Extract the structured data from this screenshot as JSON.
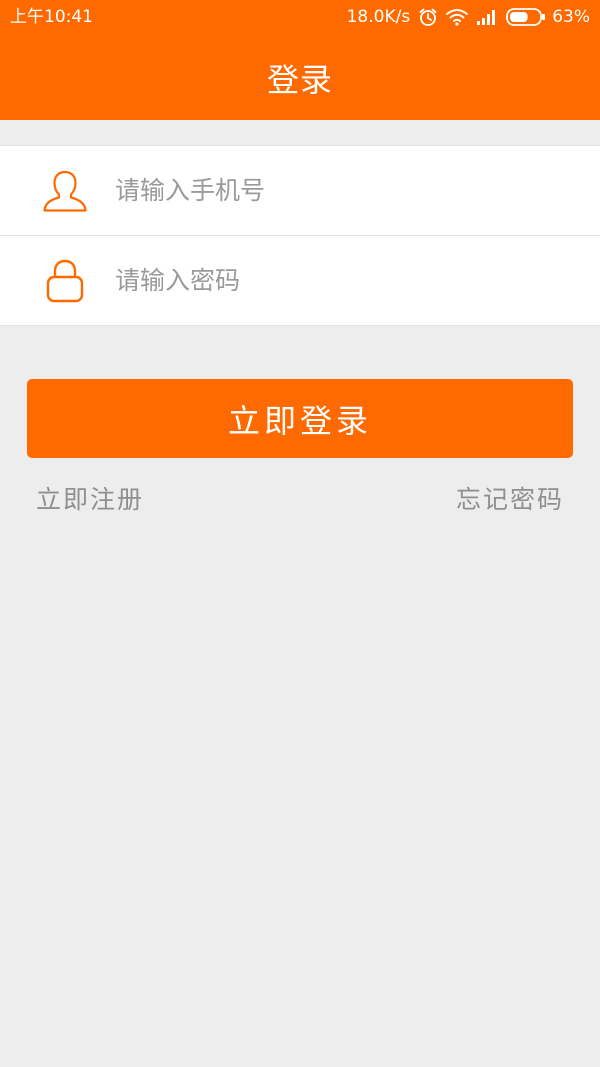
{
  "status_bar": {
    "time": "上午10:41",
    "network_speed": "18.0K/s",
    "battery_percent": "63%",
    "battery_level": 0.63,
    "icons": [
      "alarm-icon",
      "wifi-icon",
      "signal-icon",
      "battery-icon"
    ]
  },
  "header": {
    "title": "登录"
  },
  "form": {
    "phone": {
      "placeholder": "请输入手机号",
      "value": "",
      "icon": "user-icon"
    },
    "password": {
      "placeholder": "请输入密码",
      "value": "",
      "icon": "lock-icon"
    }
  },
  "actions": {
    "login_label": "立即登录",
    "register_label": "立即注册",
    "forgot_label": "忘记密码"
  },
  "colors": {
    "accent": "#ff6a00",
    "background": "#ededed",
    "card": "#ffffff",
    "placeholder": "#9a9a9a",
    "link": "#8f8f8f"
  }
}
